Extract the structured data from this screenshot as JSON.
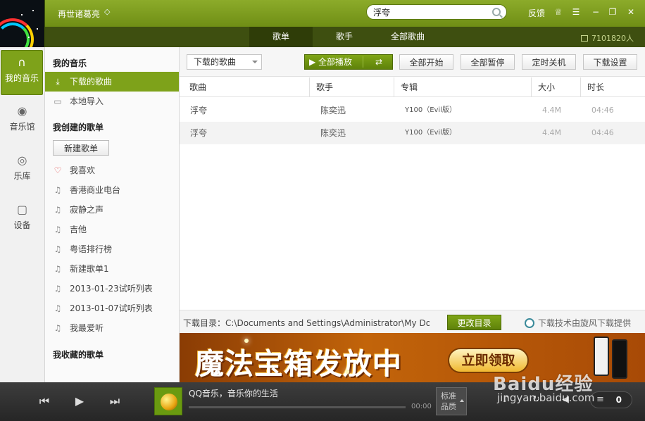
{
  "titlebar": {
    "username": "再世诸葛亮",
    "diamond_icon": "diamond-icon",
    "search_value": "浮夸",
    "feedback_label": "反馈",
    "icons": [
      "skin-icon",
      "menu-icon",
      "minimize-icon",
      "restore-icon",
      "close-icon"
    ]
  },
  "tabs": [
    {
      "label": "歌单",
      "active": true
    },
    {
      "label": "歌手",
      "active": false
    },
    {
      "label": "全部歌曲",
      "active": false
    }
  ],
  "stats": {
    "label": "7101820人"
  },
  "leftnav": [
    {
      "label": "我的音乐",
      "icon": "headphones-icon",
      "active": true
    },
    {
      "label": "音乐馆",
      "icon": "music-hall-icon",
      "active": false
    },
    {
      "label": "乐库",
      "icon": "target-icon",
      "active": false
    },
    {
      "label": "设备",
      "icon": "device-icon",
      "active": false
    }
  ],
  "sidebar": {
    "my_music_heading": "我的音乐",
    "my_music_items": [
      {
        "label": "下载的歌曲",
        "icon": "download-icon",
        "active": true
      },
      {
        "label": "本地导入",
        "icon": "monitor-icon",
        "active": false
      }
    ],
    "created_heading": "我创建的歌单",
    "new_playlist_label": "新建歌单",
    "playlists": [
      {
        "label": "我喜欢",
        "icon": "heart-icon"
      },
      {
        "label": "香港商业电台",
        "icon": "music-note-icon"
      },
      {
        "label": "寂静之声",
        "icon": "music-note-icon"
      },
      {
        "label": "吉他",
        "icon": "music-note-icon"
      },
      {
        "label": "粤语排行榜",
        "icon": "music-note-icon"
      },
      {
        "label": "新建歌单1",
        "icon": "music-note-icon"
      },
      {
        "label": "2013-01-23试听列表",
        "icon": "music-note-icon"
      },
      {
        "label": "2013-01-07试听列表",
        "icon": "music-note-icon"
      },
      {
        "label": "我最爱听",
        "icon": "music-note-icon"
      }
    ],
    "collected_heading": "我收藏的歌单"
  },
  "toolbar": {
    "filter_label": "下载的歌曲",
    "play_all_label": "全部播放",
    "start_all_label": "全部开始",
    "pause_all_label": "全部暂停",
    "timer_label": "定时关机",
    "settings_label": "下载设置"
  },
  "table": {
    "columns": [
      "歌曲",
      "歌手",
      "专辑",
      "大小",
      "时长"
    ],
    "rows": [
      {
        "song": "浮夸",
        "artist": "陈奕迅",
        "album": "Y100（Evil版）",
        "size": "4.4M",
        "duration": "04:46"
      },
      {
        "song": "浮夸",
        "artist": "陈奕迅",
        "album": "Y100（Evil版）",
        "size": "4.4M",
        "duration": "04:46"
      }
    ]
  },
  "download_bar": {
    "path_text": "下载目录：C:\\Documents and Settings\\Administrator\\My Doc...",
    "change_dir_label": "更改目录",
    "credit_text": "下载技术由旋风下载提供"
  },
  "banner": {
    "title": "魔法宝箱发放中",
    "button_label": "立即领取"
  },
  "player": {
    "now_playing": "QQ音乐，音乐你的生活",
    "time": "00:00",
    "progress": 0,
    "quality_label": "标准品质",
    "playlist_count": "0"
  },
  "watermark": {
    "brand": "Baidu经验",
    "url": "jingyan.baidu.com"
  },
  "colors": {
    "accent": "#7ea21a",
    "titlebar": "#7c9c1e",
    "tabbar": "#3e4f10",
    "player": "#2f2f2f"
  }
}
